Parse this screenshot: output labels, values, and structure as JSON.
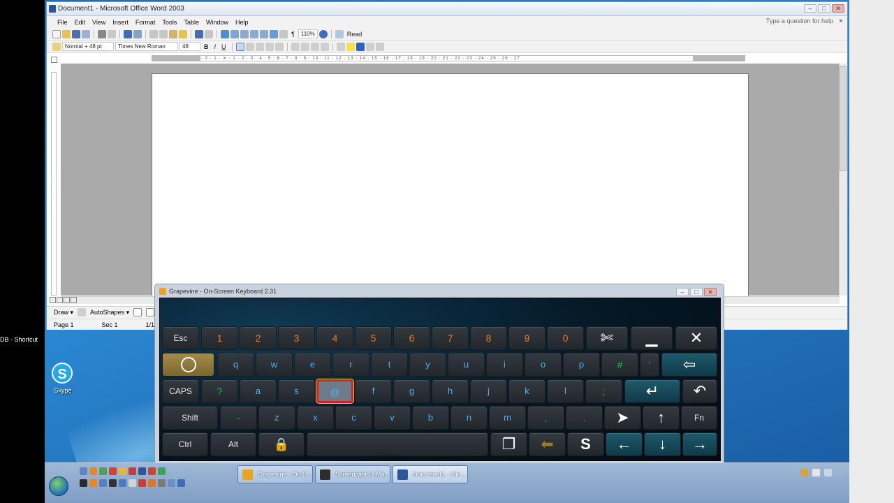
{
  "desktop": {
    "item_label": "DB - Shortcut",
    "skype_glyph": "S",
    "skype_label": "Skype"
  },
  "word": {
    "title": "Document1 - Microsoft Office Word 2003",
    "menu": [
      "File",
      "Edit",
      "View",
      "Insert",
      "Format",
      "Tools",
      "Table",
      "Window",
      "Help"
    ],
    "ask_placeholder": "Type a question for help",
    "ask_close": "×",
    "zoom": "110%",
    "read_label": "Read",
    "style_value": "Normal + 48 pt",
    "font_value": "Times New Roman",
    "size_value": "48",
    "bold": "B",
    "italic": "I",
    "underline": "U",
    "ruler_text": "· 2 · 1 · ✕ · 1 · 2 · 3 · 4 · 5 · 6 · 7 · 8 · 9 · 10 · 11 · 12 · 13 · 14 · 15 · 16 · 17 · 18 · 19 · 20 · 21 · 22 · 23 · 24 · 25 · 26 · 27",
    "draw_label": "Draw ▾",
    "autoshapes_label": "AutoShapes ▾",
    "status": {
      "page": "Page 1",
      "sec": "Sec 1",
      "page_of": "1/1"
    }
  },
  "window_buttons": {
    "minimize": "–",
    "maximize": "□",
    "close": "✕"
  },
  "osk": {
    "title": "Grapevine - On-Screen Keyboard 2.31",
    "keys": {
      "esc": "Esc",
      "numbers": [
        "1",
        "2",
        "3",
        "4",
        "5",
        "6",
        "7",
        "8",
        "9",
        "0"
      ],
      "settings_icon": "✄",
      "minimize_icon": "▁",
      "close_icon": "✕",
      "row2": [
        "q",
        "w",
        "e",
        "r",
        "t",
        "y",
        "u",
        "i",
        "o",
        "p"
      ],
      "hash": "#",
      "apostrophe": "'",
      "backspace_icon": "⇦",
      "caps": "CAPS",
      "question": "?",
      "row3": [
        "a",
        "s",
        "@",
        "f",
        "g",
        "h",
        "j",
        "k",
        "l"
      ],
      "semicolon": ";",
      "enter_icon": "↵",
      "undo_icon": "↶",
      "shift": "Shift",
      "dash": "-",
      "row4": [
        "z",
        "x",
        "c",
        "v",
        "b",
        "n",
        "m"
      ],
      "comma": ",",
      "period": ".",
      "pointer_icon": "➤",
      "up_icon": "↑",
      "fn": "Fn",
      "ctrl": "Ctrl",
      "alt": "Alt",
      "lock_icon": "🔒",
      "window_icon": "❐",
      "back_arrow_icon": "⬅",
      "superman_icon": "S",
      "left_icon": "←",
      "down_icon": "↓",
      "right_icon": "→"
    },
    "selected_key": "@"
  },
  "taskbar": {
    "tasks": [
      {
        "label": "Grapevine - On-S..."
      },
      {
        "label": "Screencast-O-Ma..."
      },
      {
        "label": "Document1 - Mic..."
      }
    ],
    "task_icons": [
      "grapevine-icon",
      "screencast-icon",
      "word-icon"
    ]
  },
  "colors": {
    "accent_blue": "#4cb1ef",
    "number_orange": "#e87a2c",
    "selected_red": "#d42120"
  }
}
